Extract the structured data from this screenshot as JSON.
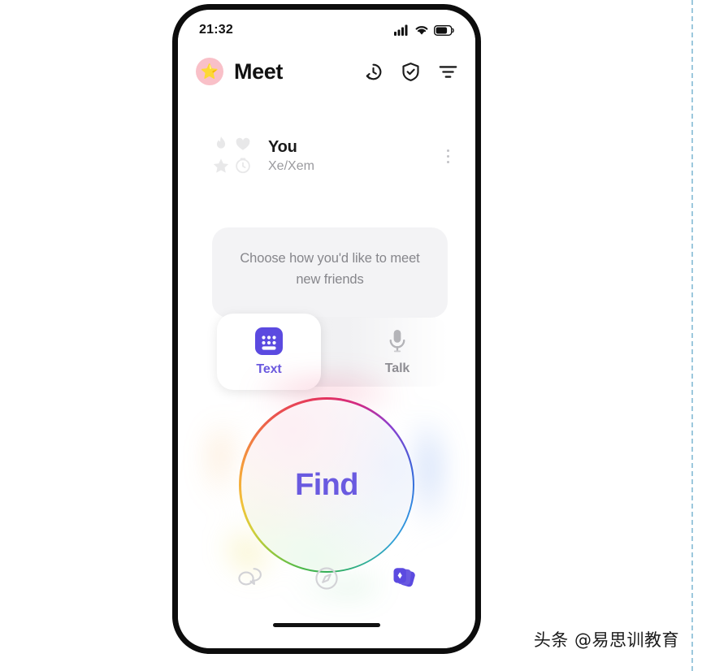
{
  "status_bar": {
    "time": "21:32",
    "signal_icon": "signal-bars-icon",
    "wifi_icon": "wifi-icon",
    "battery_icon": "battery-icon"
  },
  "header": {
    "avatar_icon": "star-avatar-icon",
    "avatar_glyph": "⭐",
    "title": "Meet",
    "actions": [
      {
        "name": "history-icon",
        "label": "History"
      },
      {
        "name": "shield-check-icon",
        "label": "Safety"
      },
      {
        "name": "filter-icon",
        "label": "Filter"
      }
    ]
  },
  "profile": {
    "name": "You",
    "pronouns": "Xe/Xem",
    "badges": [
      {
        "name": "flame-icon"
      },
      {
        "name": "heart-icon"
      },
      {
        "name": "star-icon"
      },
      {
        "name": "clock-icon"
      }
    ],
    "menu_icon": "more-options-icon"
  },
  "prompt": {
    "text": "Choose how you'd like to meet new friends"
  },
  "modes": {
    "selected": "Text",
    "options": [
      {
        "label": "Text",
        "icon": "keyboard-icon",
        "selected": true
      },
      {
        "label": "Talk",
        "icon": "microphone-icon",
        "selected": false
      }
    ]
  },
  "find_button": {
    "label": "Find"
  },
  "bottom_nav": {
    "items": [
      {
        "name": "chat-bubbles-icon",
        "label": "Chats",
        "active": false
      },
      {
        "name": "compass-explore-icon",
        "label": "Explore",
        "active": false
      },
      {
        "name": "cards-add-icon",
        "label": "Meet",
        "active": true
      }
    ]
  },
  "colors": {
    "accent_purple": "#6a5ae0",
    "avatar_pink": "#f9c0c8",
    "muted_gray": "#8e8e93",
    "card_gray": "#f3f3f5"
  },
  "watermark": {
    "text": "头条 @易思训教育"
  }
}
